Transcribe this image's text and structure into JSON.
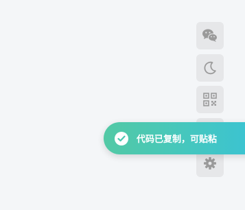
{
  "sidebar": {
    "buttons": [
      {
        "icon": "wechat-icon"
      },
      {
        "icon": "moon-icon"
      },
      {
        "icon": "qrcode-icon"
      },
      {
        "icon": "unknown-icon"
      },
      {
        "icon": "gear-icon"
      }
    ],
    "icon_color": "#9a9a9a"
  },
  "toast": {
    "message": "代码已复制，可贴粘",
    "icon": "check-circle-icon",
    "gradient_start": "#52c9a5",
    "gradient_end": "#3bc3d3"
  }
}
